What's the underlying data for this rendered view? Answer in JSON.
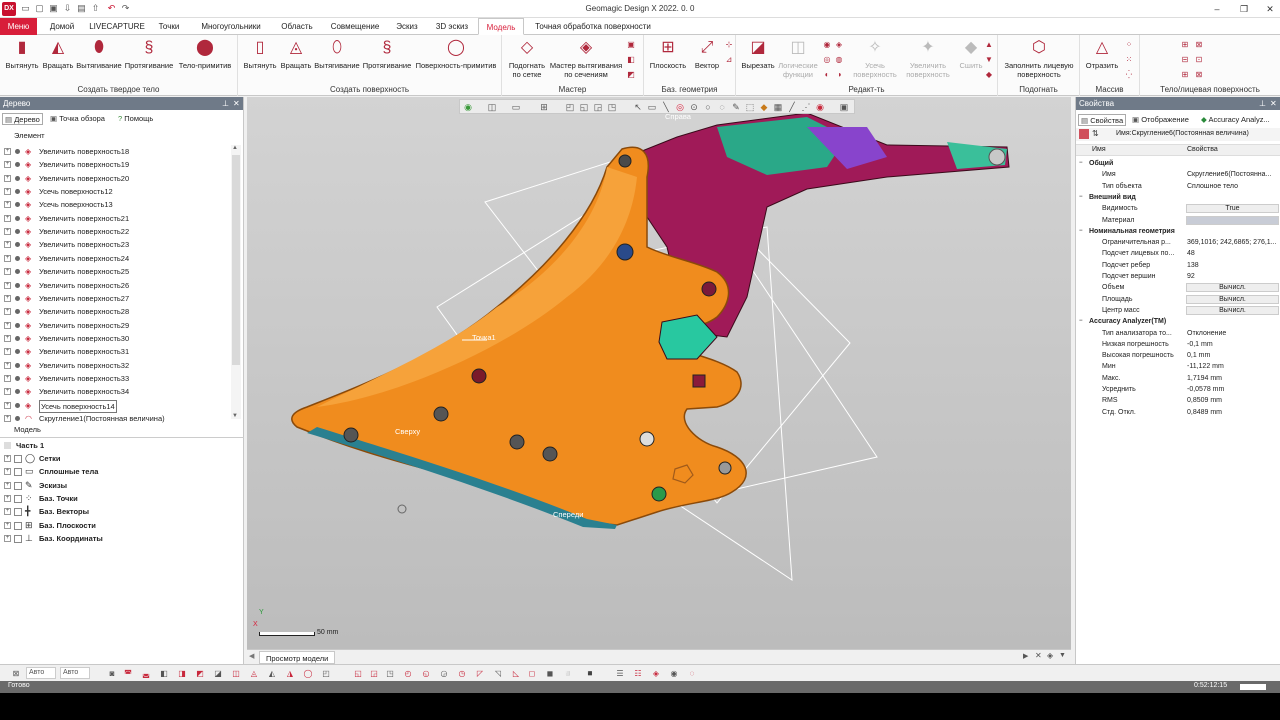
{
  "app": {
    "title": "Geomagic Design X 2022. 0. 0",
    "icon_label": "DX",
    "accent": "#d81e3a"
  },
  "tabs": [
    "Меню",
    "Домой",
    "LIVECAPTURE",
    "Точки",
    "Многоугольники",
    "Область",
    "Совмещение",
    "Эскиз",
    "3D эскиз",
    "Модель",
    "Точная обработка поверхности"
  ],
  "active_tab": "Модель",
  "ribbon": {
    "groups": [
      {
        "label": "Создать твердое тело",
        "buttons": [
          "Вытянуть",
          "Вращать",
          "Вытягивание",
          "Протягивание",
          "Тело-примитив"
        ]
      },
      {
        "label": "Создать поверхность",
        "buttons": [
          "Вытянуть",
          "Вращать",
          "Вытягивание",
          "Протягивание",
          "Поверхность-примитив"
        ]
      },
      {
        "label": "Мастер",
        "buttons": [
          "Подогнать по сетке",
          "Мастер вытягивания по сечениям"
        ]
      },
      {
        "label": "Баз. геометрия",
        "buttons": [
          "Плоскость",
          "Вектор"
        ]
      },
      {
        "label": "Редакт-ть",
        "buttons": [
          "Вырезать",
          "Логические функции",
          "Усечь поверхность",
          "Увеличить поверхность",
          "Сшить"
        ]
      },
      {
        "label": "Подогнать",
        "buttons": [
          "Заполнить лицевую поверхность"
        ]
      },
      {
        "label": "Массив",
        "buttons": [
          "Отразить"
        ]
      },
      {
        "label": "Тело/лицевая поверхность",
        "buttons": []
      }
    ]
  },
  "tree_panel": {
    "title": "Дерево",
    "subtabs": [
      "Дерево",
      "Точка обзора",
      "Помощь"
    ],
    "section_label": "Элемент",
    "items": [
      "Увеличить поверхность18",
      "Увеличить поверхность19",
      "Увеличить поверхность20",
      "Усечь поверхность12",
      "Усечь поверхность13",
      "Увеличить поверхность21",
      "Увеличить поверхность22",
      "Увеличить поверхность23",
      "Увеличить поверхность24",
      "Увеличить поверхность25",
      "Увеличить поверхность26",
      "Увеличить поверхность27",
      "Увеличить поверхность28",
      "Увеличить поверхность29",
      "Увеличить поверхность30",
      "Увеличить поверхность31",
      "Увеличить поверхность32",
      "Увеличить поверхность33",
      "Увеличить поверхность34",
      "Усечь поверхность14",
      "Скругление1(Постоянная величина)"
    ],
    "selected_index": 19,
    "model_label": "Модель",
    "part_label": "Часть 1",
    "model_items": [
      "Сетки",
      "Сплошные тела",
      "Эскизы",
      "Баз. Точки",
      "Баз. Векторы",
      "Баз. Плоскости",
      "Баз. Координаты"
    ]
  },
  "viewport": {
    "labels": {
      "top": "Справа",
      "point": "Точка1",
      "upper": "Сверху",
      "front": "Спереди"
    },
    "scale_label": "50 mm",
    "axis_x": "X",
    "axis_y": "Y",
    "tab_label": "Просмотр модели",
    "part_color": "#f08c1e"
  },
  "props_panel": {
    "title": "Свойства",
    "tabs": [
      "Свойства",
      "Отображение",
      "Accuracy Analyz..."
    ],
    "name_header": "Имя:Скругление6(Постоянная величина)",
    "col_name": "Имя",
    "col_value": "Свойства",
    "sections": [
      {
        "label": "Общий",
        "rows": [
          {
            "name": "Имя",
            "value": "Скругление6(Постоянна..."
          },
          {
            "name": "Тип объекта",
            "value": "Сплошное тело"
          }
        ]
      },
      {
        "label": "Внешний вид",
        "rows": [
          {
            "name": "Видимость",
            "value": "True",
            "button": true
          },
          {
            "name": "Материал",
            "value": "",
            "swatch": true
          }
        ]
      },
      {
        "label": "Номинальная геометрия",
        "rows": [
          {
            "name": "Ограничительная р...",
            "value": "369,1016; 242,6865; 276,1..."
          },
          {
            "name": "Подсчет лицевых по...",
            "value": "48"
          },
          {
            "name": "Подсчет ребер",
            "value": "138"
          },
          {
            "name": "Подсчет вершин",
            "value": "92"
          },
          {
            "name": "Объем",
            "value": "Вычисл.",
            "button": true
          },
          {
            "name": "Площадь",
            "value": "Вычисл.",
            "button": true
          },
          {
            "name": "Центр масс",
            "value": "Вычисл.",
            "button": true
          }
        ]
      },
      {
        "label": "Accuracy Analyzer(TM)",
        "rows": [
          {
            "name": "Тип анализатора то...",
            "value": "Отклонение"
          },
          {
            "name": "Низкая погрешность",
            "value": "-0,1 mm"
          },
          {
            "name": "Высокая погрешность",
            "value": "0,1 mm"
          },
          {
            "name": "Мин",
            "value": "-11,122 mm"
          },
          {
            "name": "Макс.",
            "value": "1,7194 mm"
          },
          {
            "name": "Усреднить",
            "value": "-0,0578 mm"
          },
          {
            "name": "RMS",
            "value": "0,8509 mm"
          },
          {
            "name": "Стд. Откл.",
            "value": "0,8489 mm"
          }
        ]
      }
    ]
  },
  "bottom_toolbar": {
    "mode1": "Авто",
    "mode2": "Авто"
  },
  "status": {
    "text": "Готово",
    "time": "0:52:12:15"
  }
}
